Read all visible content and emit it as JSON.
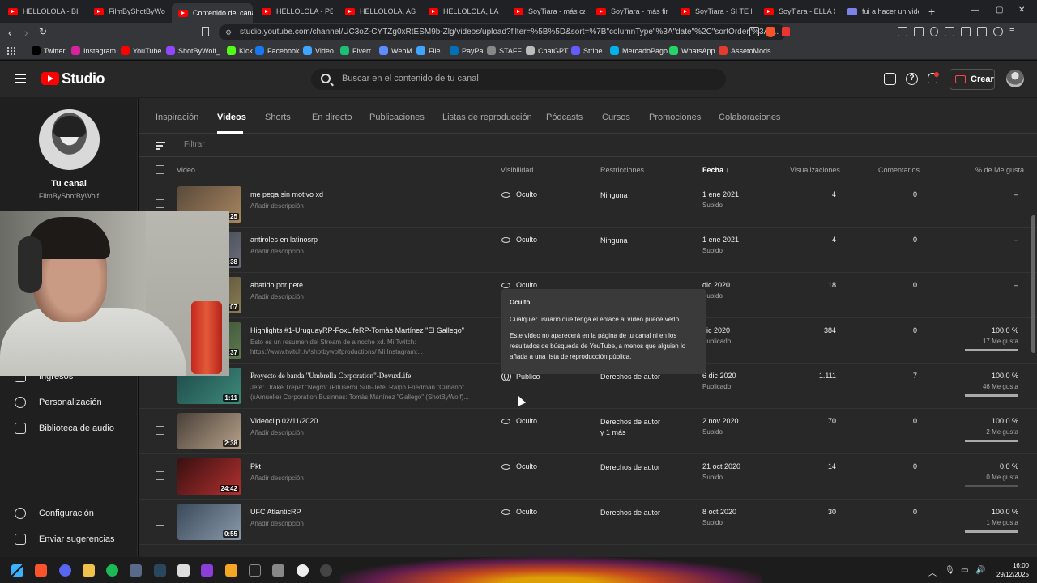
{
  "browser": {
    "tabs": [
      {
        "label": "HELLOLOLA - BIX AI",
        "icon": "youtube-icon"
      },
      {
        "label": "FilmByShotByWolf",
        "icon": "youtube-icon"
      },
      {
        "label": "Contenido del canal",
        "icon": "youtube-icon",
        "active": true
      },
      {
        "label": "HELLOLOLA - PERR",
        "icon": "youtube-icon"
      },
      {
        "label": "HELLOLOLA, ASAN",
        "icon": "youtube-icon"
      },
      {
        "label": "HELLOLOLA, LA CH",
        "icon": "youtube-icon"
      },
      {
        "label": "SoyTiara - más cara",
        "icon": "youtube-icon"
      },
      {
        "label": "SoyTiara - más fina",
        "icon": "youtube-icon"
      },
      {
        "label": "SoyTiara - SI TE DIG",
        "icon": "youtube-icon"
      },
      {
        "label": "SoyTiara - ELLA QUI",
        "icon": "youtube-icon"
      },
      {
        "label": "fui a hacer un video",
        "icon": "teams-icon"
      }
    ],
    "url": "studio.youtube.com/channel/UC3oZ-CYTZg0xRtESM9b-Zlg/videos/upload?filter=%5B%5D&sort=%7B\"columnType\"%3A\"date\"%2C\"sortOrder\"%3A\"...",
    "bookmarks": [
      {
        "label": "Twitter",
        "color": "#000000"
      },
      {
        "label": "Instagram",
        "color": "#d6249f"
      },
      {
        "label": "YouTube",
        "color": "#ff0000"
      },
      {
        "label": "ShotByWolf_",
        "color": "#9146ff"
      },
      {
        "label": "Kick",
        "color": "#53fc18"
      },
      {
        "label": "Facebook",
        "color": "#1877f2"
      },
      {
        "label": "Video",
        "color": "#3ea6ff"
      },
      {
        "label": "Fiverr",
        "color": "#1dbf73"
      },
      {
        "label": "WebM",
        "color": "#5c8cff"
      },
      {
        "label": "File",
        "color": "#3ea6ff"
      },
      {
        "label": "PayPal",
        "color": "#0070ba"
      },
      {
        "label": "STAFF",
        "color": "#888888"
      },
      {
        "label": "ChatGPT",
        "color": "#bbbbbb"
      },
      {
        "label": "Stripe",
        "color": "#635bff"
      },
      {
        "label": "MercadoPago",
        "color": "#00b1ea"
      },
      {
        "label": "WhatsApp",
        "color": "#25d366"
      },
      {
        "label": "AssetoMods",
        "color": "#e33b2e"
      }
    ]
  },
  "header": {
    "brand": "Studio",
    "search_placeholder": "Buscar en el contenido de tu canal",
    "create_label": "Crear"
  },
  "sidebar": {
    "channel_title": "Tu canal",
    "channel_name": "FilmByShotByWolf",
    "items": [
      {
        "label": "Ingresos",
        "icon": "dollar-icon"
      },
      {
        "label": "Personalización",
        "icon": "brush-icon"
      },
      {
        "label": "Biblioteca de audio",
        "icon": "audio-library-icon"
      }
    ],
    "footer_items": [
      {
        "label": "Configuración",
        "icon": "gear-icon"
      },
      {
        "label": "Enviar sugerencias",
        "icon": "feedback-icon"
      }
    ]
  },
  "content_tabs": [
    "Inspiración",
    "Videos",
    "Shorts",
    "En directo",
    "Publicaciones",
    "Listas de reproducción",
    "Pódcasts",
    "Cursos",
    "Promociones",
    "Colaboraciones"
  ],
  "active_tab": "Videos",
  "filter_placeholder": "Filtrar",
  "table": {
    "headers": {
      "video": "Video",
      "visibility": "Visibilidad",
      "restrictions": "Restricciones",
      "date": "Fecha",
      "views": "Visualizaciones",
      "comments": "Comentarios",
      "likes": "% de Me gusta"
    },
    "rows": [
      {
        "title": "me pega sin motivo xd",
        "desc": "Añadir descripción",
        "duration": "0:25",
        "visibility": "Oculto",
        "restriction": "Ninguna",
        "date": "1 ene 2021",
        "status": "Subido",
        "views": "4",
        "comments": "0",
        "likes": "–",
        "likes_sub": "",
        "like_ratio": null,
        "thumb": [
          "#5a4a3a",
          "#a88660"
        ]
      },
      {
        "title": "antiroles en latinosrp",
        "desc": "Añadir descripción",
        "duration": "0:38",
        "visibility": "Oculto",
        "restriction": "Ninguna",
        "date": "1 ene 2021",
        "status": "Subido",
        "views": "4",
        "comments": "0",
        "likes": "–",
        "likes_sub": "",
        "like_ratio": null,
        "thumb": [
          "#30343c",
          "#6a6f7a"
        ]
      },
      {
        "title": "abatido por pete",
        "desc": "Añadir descripción",
        "duration": "0:07",
        "visibility": "Oculto",
        "restriction": "",
        "date": "dic 2020",
        "status": "Subido",
        "views": "18",
        "comments": "0",
        "likes": "–",
        "likes_sub": "",
        "like_ratio": null,
        "thumb": [
          "#3d3a2c",
          "#8c7e55"
        ]
      },
      {
        "title": "Highlights #1-UruguayRP-FoxLifeRP-Tomàs Martínez \"El Gallego\"",
        "desc": "Esto es un resumen del Stream de a noche xd. Mi Twitch:\nhttps://www.twitch.tv/shotbywolfproductions/ Mi Instagram:...",
        "duration": "0:37",
        "visibility": "",
        "restriction": "",
        "date": "dic 2020",
        "status": "Publicado",
        "views": "384",
        "comments": "0",
        "likes": "100,0 %",
        "likes_sub": "17 Me gusta",
        "like_ratio": 1.0,
        "thumb": [
          "#2c3a2e",
          "#5e7a4e"
        ]
      },
      {
        "title": "Proyecto de banda \"Umbrella Corporation\"-DovuxLife",
        "desc": "Jefe: Drake Trepat \"Negro\" (Pitusero) Sub-Jefe: Ralph Friedman \"Cubano\"\n(sAmuelle) Corporation Businnes: Tomàs Martínez \"Gallego\" (ShotByWolf)...",
        "duration": "1:11",
        "visibility": "Público",
        "restriction": "Derechos de autor",
        "date": "6 dic 2020",
        "status": "Publicado",
        "views": "1.111",
        "comments": "7",
        "likes": "100,0 %",
        "likes_sub": "46 Me gusta",
        "like_ratio": 1.0,
        "thumb": [
          "#1e4a4a",
          "#3e8a7a"
        ]
      },
      {
        "title": "Videoclip 02/11/2020",
        "desc": "Añadir descripción",
        "duration": "2:38",
        "visibility": "Oculto",
        "restriction": "Derechos de autor\ny 1 más",
        "date": "2 nov 2020",
        "status": "Subido",
        "views": "70",
        "comments": "0",
        "likes": "100,0 %",
        "likes_sub": "2 Me gusta",
        "like_ratio": 1.0,
        "thumb": [
          "#4a4038",
          "#b6a28a"
        ]
      },
      {
        "title": "Pkt",
        "desc": "Añadir descripción",
        "duration": "24:42",
        "visibility": "Oculto",
        "restriction": "Derechos de autor",
        "date": "21 oct 2020",
        "status": "Subido",
        "views": "14",
        "comments": "0",
        "likes": "0,0 %",
        "likes_sub": "0 Me gusta",
        "like_ratio": 0.0,
        "thumb": [
          "#3a1010",
          "#b23030"
        ]
      },
      {
        "title": "UFC AtlanticRP",
        "desc": "Añadir descripción",
        "duration": "0:55",
        "visibility": "Oculto",
        "restriction": "Derechos de autor",
        "date": "8 oct 2020",
        "status": "Subido",
        "views": "30",
        "comments": "0",
        "likes": "100,0 %",
        "likes_sub": "1 Me gusta",
        "like_ratio": 1.0,
        "thumb": [
          "#3a4a5a",
          "#8a9aaa"
        ]
      }
    ]
  },
  "tooltip": {
    "title": "Oculto",
    "line1": "Cualquier usuario que tenga el enlace al vídeo puede verlo.",
    "line2": "Este vídeo no aparecerá en la página de tu canal ni en los resultados de búsqueda de YouTube, a menos que alguien lo añada a una lista de reproducción pública."
  },
  "taskbar": {
    "time": "16:00",
    "date": "29/12/2025"
  }
}
